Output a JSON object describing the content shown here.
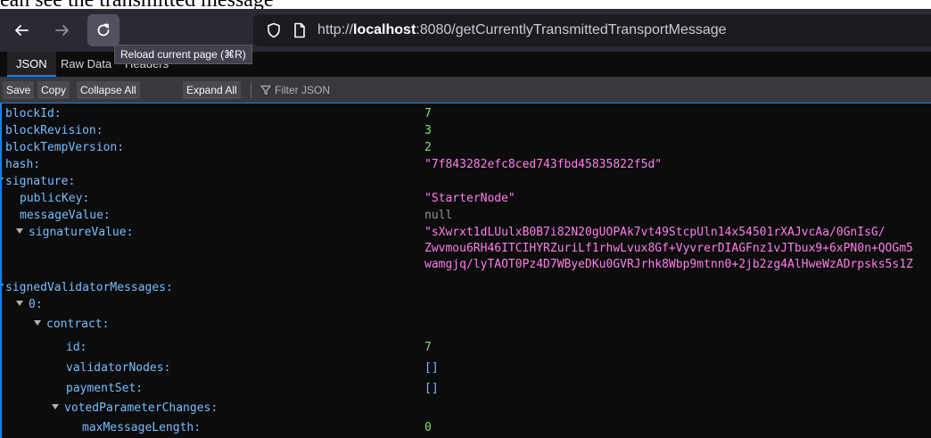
{
  "caption": "ean see the transmitted message",
  "browser": {
    "url_host": "localhost",
    "url_prefix": "http://",
    "url_rest": ":8080/getCurrentlyTransmittedTransportMessage",
    "tooltip": "Reload current page (⌘R)"
  },
  "viewer": {
    "tabs": [
      "JSON",
      "Raw Data",
      "Headers"
    ],
    "toolbar": {
      "save": "Save",
      "copy": "Copy",
      "collapse_all": "Collapse All",
      "expand_all": "Expand All",
      "filter_placeholder": "Filter JSON"
    }
  },
  "tree": {
    "blockId": {
      "key": "blockId:",
      "value": "7"
    },
    "blockRevision": {
      "key": "blockRevision:",
      "value": "3"
    },
    "blockTempVersion": {
      "key": "blockTempVersion:",
      "value": "2"
    },
    "hash": {
      "key": "hash:",
      "value": "\"7f843282efc8ced743fbd45835822f5d\""
    },
    "signature": {
      "key": "signature:"
    },
    "publicKey": {
      "key": "publicKey:",
      "value": "\"StarterNode\""
    },
    "messageValue": {
      "key": "messageValue:",
      "value": "null"
    },
    "signatureValue": {
      "key": "signatureValue:",
      "lines": [
        "\"sXwrxt1dLUulxB0B7i82N20gUOPAk7vt49StcpUln14x54501rXAJvcAa/0GnIsG/",
        "Zwvmou6RH46ITCIHYRZuriLf1rhwLvux8Gf+VyvrerDIAGFnz1vJTbux9+6xPN0n+QOGm5",
        "wamgjq/lyTAOT0Pz4D7WByeDKu0GVRJrhk8Wbp9mtnn0+2jb2zg4AlHweWzADrpsks5s1Z"
      ]
    },
    "signedValidatorMessages": {
      "key": "signedValidatorMessages:"
    },
    "index0": {
      "key": "0:"
    },
    "contract": {
      "key": "contract:"
    },
    "id": {
      "key": "id:",
      "value": "7"
    },
    "validatorNodes": {
      "key": "validatorNodes:",
      "value": "[]"
    },
    "paymentSet": {
      "key": "paymentSet:",
      "value": "[]"
    },
    "votedParameterChanges": {
      "key": "votedParameterChanges:"
    },
    "maxMessageLength": {
      "key": "maxMessageLength:",
      "value": "0"
    }
  }
}
